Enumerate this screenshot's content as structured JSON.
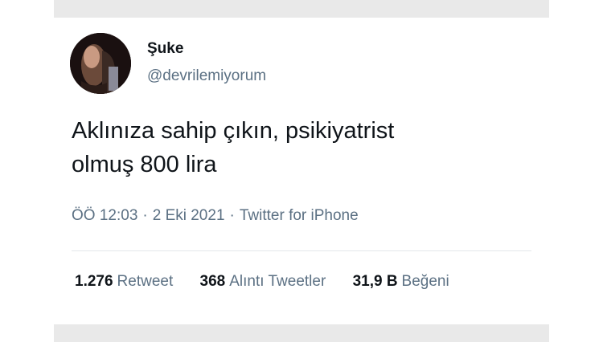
{
  "tweet": {
    "display_name": "Şuke",
    "handle": "@devrilemiyorum",
    "text_lines": [
      "Aklınıza sahip çıkın, psikiyatrist",
      "olmuş 800 lira"
    ],
    "time": "ÖÖ 12:03",
    "date": "2 Eki 2021",
    "source": "Twitter for iPhone",
    "separator": "·",
    "stats": [
      {
        "count": "1.276",
        "label": "Retweet"
      },
      {
        "count": "368",
        "label": "Alıntı Tweetler"
      },
      {
        "count": "31,9 B",
        "label": "Beğeni"
      }
    ]
  },
  "colors": {
    "text_primary": "#0f1419",
    "text_secondary": "#5b7083",
    "band": "#e9e9e9",
    "divider": "#e3e7ea"
  }
}
